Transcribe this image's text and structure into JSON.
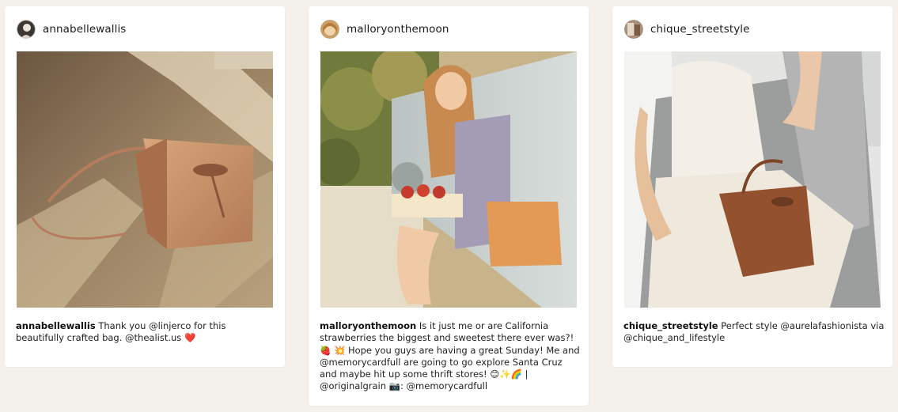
{
  "posts": [
    {
      "username": "annabellewallis",
      "caption_user": "annabellewallis",
      "caption_text": "Thank you @linjerco for this beautifully crafted bag. @thealist.us ❤️",
      "avatar_icon": "user-avatar",
      "photo_subject": "tan-bucket-bag-on-rug"
    },
    {
      "username": "malloryonthemoon",
      "caption_user": "malloryonthemoon",
      "caption_text": "Is it just me or are California strawberries the biggest and sweetest there ever was?! 🍓 💥 Hope you guys are having a great Sunday! Me and @memorycardfull are going to go explore Santa Cruz and maybe hit up some thrift stores! 😊✨🌈 | @originalgrain 📷: @memorycardfull",
      "avatar_icon": "user-avatar",
      "photo_subject": "woman-with-strawberries-and-bag"
    },
    {
      "username": "chique_streetstyle",
      "caption_user": "chique_streetstyle",
      "caption_text": "Perfect style @aurelafashionista via @chique_and_lifestyle",
      "avatar_icon": "user-avatar",
      "photo_subject": "woman-in-white-with-brown-bag"
    }
  ],
  "colors": {
    "page_background": "#f4f1ec",
    "card_background": "#ffffff",
    "text": "#222222"
  }
}
